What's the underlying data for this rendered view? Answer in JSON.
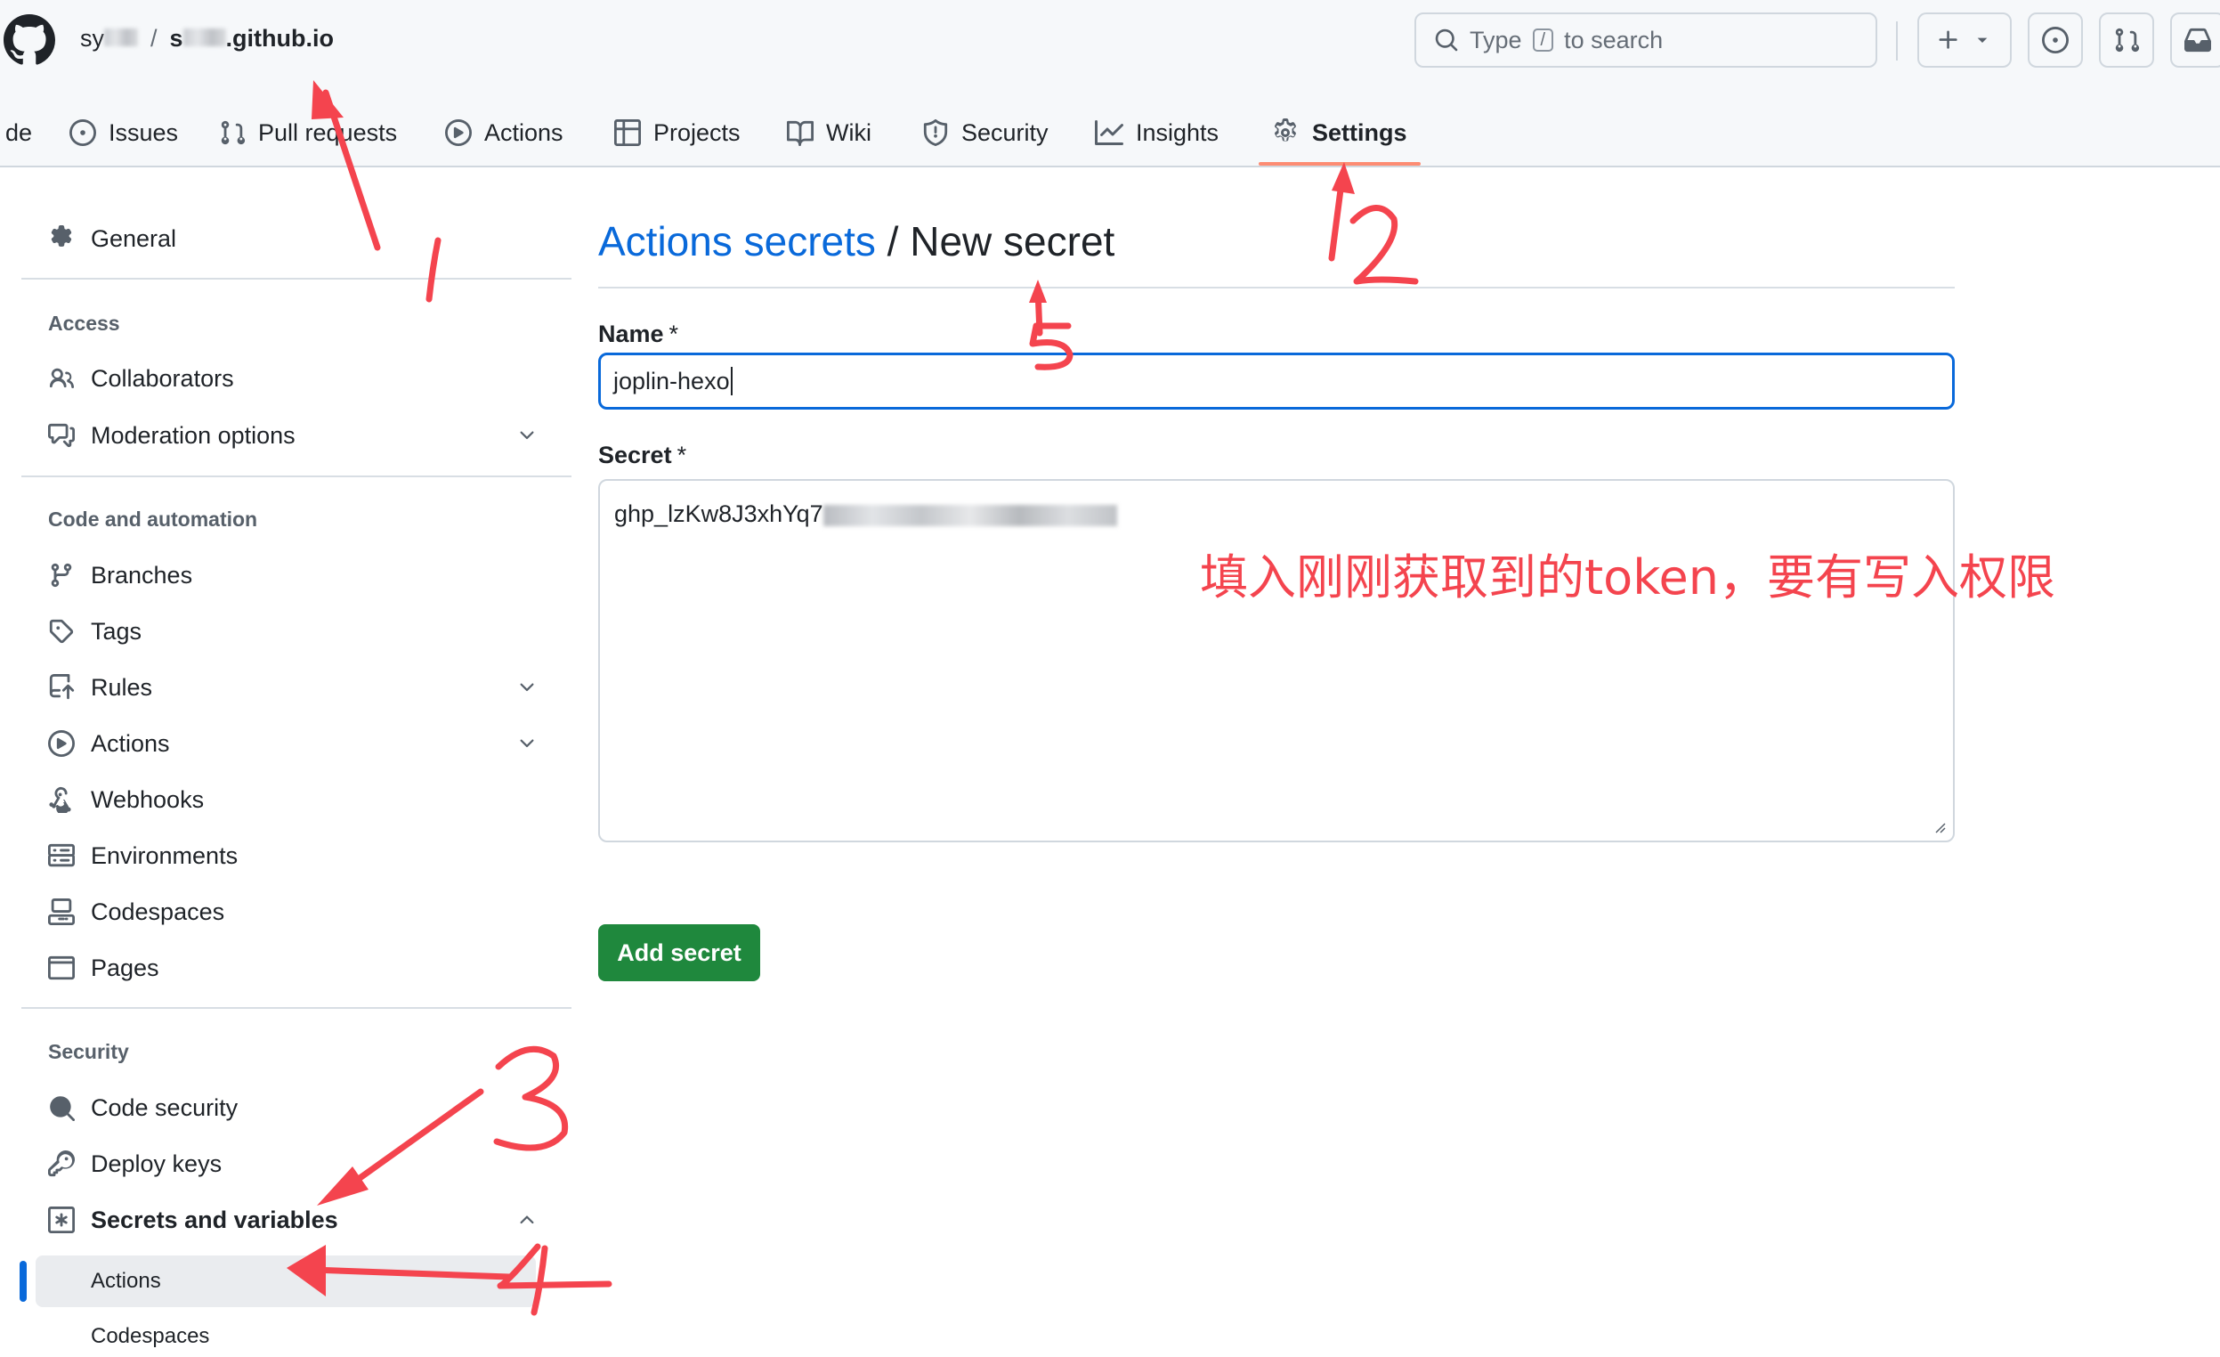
{
  "header": {
    "repo_owner_visible": "sy",
    "repo_sep": "/",
    "repo_name_prefix": "s",
    "repo_name_suffix": ".github.io",
    "search": {
      "prefix": "Type",
      "key": "/",
      "suffix": "to search"
    }
  },
  "tabs": [
    {
      "label": "de"
    },
    {
      "label": "Issues"
    },
    {
      "label": "Pull requests"
    },
    {
      "label": "Actions"
    },
    {
      "label": "Projects"
    },
    {
      "label": "Wiki"
    },
    {
      "label": "Security"
    },
    {
      "label": "Insights"
    },
    {
      "label": "Settings"
    }
  ],
  "sidebar": {
    "general": "General",
    "access_heading": "Access",
    "collaborators": "Collaborators",
    "moderation": "Moderation options",
    "code_heading": "Code and automation",
    "branches": "Branches",
    "tags": "Tags",
    "rules": "Rules",
    "actions": "Actions",
    "webhooks": "Webhooks",
    "environments": "Environments",
    "codespaces": "Codespaces",
    "pages": "Pages",
    "security_heading": "Security",
    "code_security": "Code security",
    "deploy_keys": "Deploy keys",
    "secrets_vars": "Secrets and variables",
    "sub_actions": "Actions",
    "sub_codespaces": "Codespaces"
  },
  "main": {
    "breadcrumb_link": "Actions secrets",
    "breadcrumb_sep": " / ",
    "breadcrumb_current": "New secret",
    "name_label": "Name",
    "required_mark": "*",
    "name_value": "joplin-hexo",
    "secret_label": "Secret",
    "secret_value_visible": "ghp_lzKw8J3xhYq7",
    "add_button": "Add secret"
  },
  "annotations": {
    "note": "填入刚刚获取到的token，要有写入权限",
    "color": "#f4444e"
  }
}
